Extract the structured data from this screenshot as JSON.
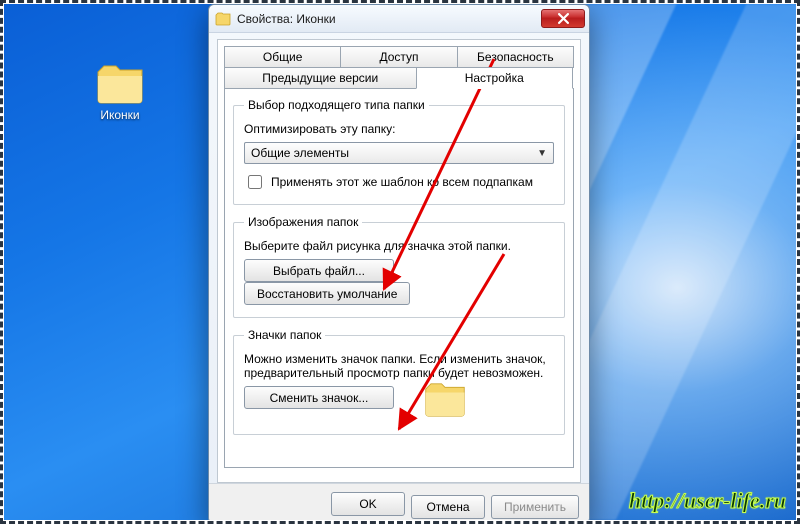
{
  "desktop": {
    "icon_label": "Иконки"
  },
  "dialog": {
    "title": "Свойства: Иконки",
    "tabs_row1": [
      "Общие",
      "Доступ",
      "Безопасность"
    ],
    "tabs_row2": [
      "Предыдущие версии",
      "Настройка"
    ],
    "active_tab": "Настройка",
    "section_type": {
      "legend": "Выбор подходящего типа папки",
      "optimize_label": "Оптимизировать эту папку:",
      "combo_value": "Общие элементы",
      "apply_sub_label": "Применять этот же шаблон ко всем подпапкам"
    },
    "section_images": {
      "legend": "Изображения папок",
      "hint": "Выберите файл рисунка для значка этой папки.",
      "choose_btn": "Выбрать файл...",
      "restore_btn": "Восстановить умолчание"
    },
    "section_icons": {
      "legend": "Значки папок",
      "hint": "Можно изменить значок папки. Если изменить значок, предварительный просмотр папки будет невозможен.",
      "change_btn": "Сменить значок..."
    },
    "buttons": {
      "ok": "OK",
      "cancel": "Отмена",
      "apply": "Применить"
    }
  },
  "watermark": "http://user-life.ru"
}
